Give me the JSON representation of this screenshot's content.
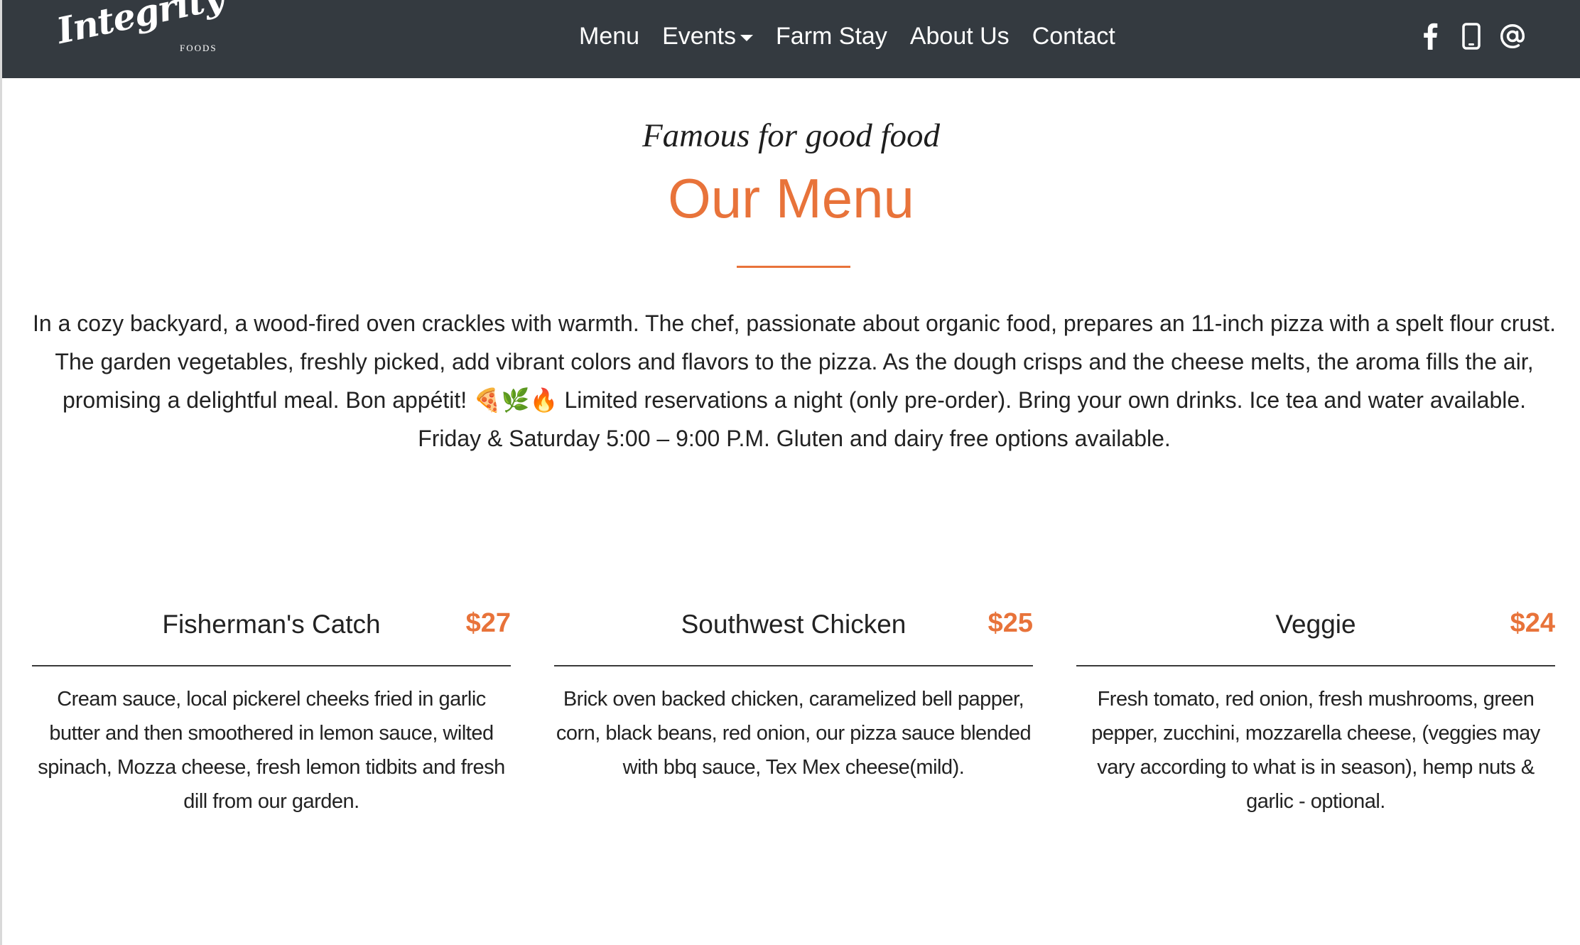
{
  "brand": {
    "script": "Integrity",
    "sub": "FOODS"
  },
  "nav": {
    "items": [
      {
        "label": "Menu"
      },
      {
        "label": "Events"
      },
      {
        "label": "Farm Stay"
      },
      {
        "label": "About Us"
      },
      {
        "label": "Contact"
      }
    ],
    "social_icons": [
      "facebook-icon",
      "phone-icon",
      "email-at-icon"
    ]
  },
  "hero": {
    "tagline": "Famous for good food",
    "title": "Our Menu",
    "intro": "In a cozy backyard, a wood-fired oven crackles with warmth. The chef, passionate about organic food, prepares an 11-inch pizza with a spelt flour crust. The garden vegetables, freshly picked, add vibrant colors and flavors to the pizza. As the dough crisps and the cheese melts, the aroma fills the air, promising a delightful meal. Bon appétit! 🍕🌿🔥 Limited reservations a night (only pre-order). Bring your own drinks. Ice tea and water available. Friday & Saturday 5:00 – 9:00 P.M. Gluten and dairy free options available."
  },
  "menu": {
    "items": [
      {
        "name": "Fisherman's Catch",
        "price": "$27",
        "description": "Cream sauce, local pickerel cheeks fried in garlic butter and then smoothered in lemon sauce, wilted spinach, Mozza cheese, fresh lemon tidbits and fresh dill from our garden."
      },
      {
        "name": "Southwest Chicken",
        "price": "$25",
        "description": "Brick oven backed chicken, caramelized bell papper, corn, black beans, red onion, our pizza sauce blended with bbq sauce, Tex Mex cheese(mild)."
      },
      {
        "name": "Veggie",
        "price": "$24",
        "description": "Fresh tomato, red onion, fresh mushrooms, green pepper, zucchini, mozzarella cheese, (veggies may vary according to what is in season), hemp nuts & garlic - optional."
      }
    ]
  },
  "colors": {
    "navbar_bg": "#343a40",
    "accent": "#e8733a",
    "text": "#222222"
  }
}
